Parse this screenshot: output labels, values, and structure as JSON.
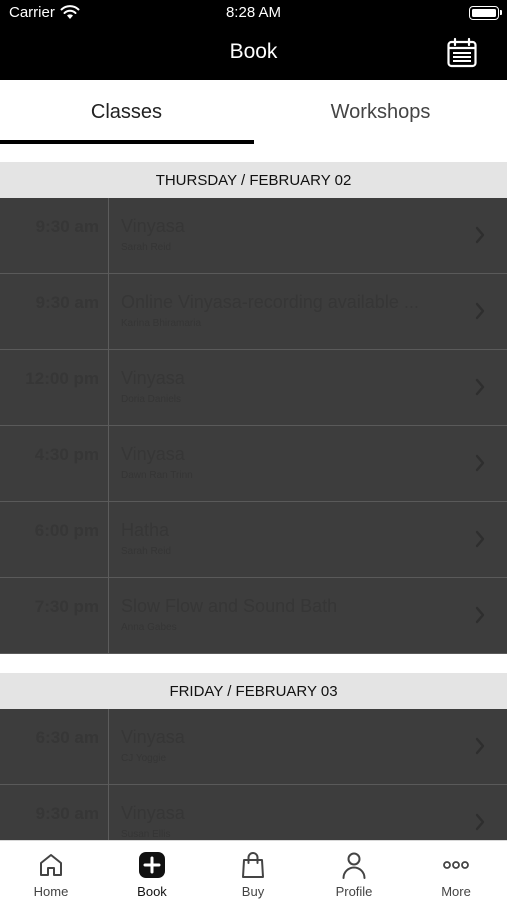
{
  "status": {
    "carrier": "Carrier",
    "time": "8:28 AM"
  },
  "nav": {
    "title": "Book"
  },
  "tabs": [
    {
      "label": "Classes"
    },
    {
      "label": "Workshops"
    }
  ],
  "days": [
    {
      "header": "THURSDAY / FEBRUARY 02",
      "rows": [
        {
          "time": "9:30 am",
          "name": "Vinyasa",
          "instructor": "Sarah Reid"
        },
        {
          "time": "9:30 am",
          "name": "Online Vinyasa-recording available ...",
          "instructor": "Karina Bhiramaria"
        },
        {
          "time": "12:00 pm",
          "name": "Vinyasa",
          "instructor": "Doria Daniels"
        },
        {
          "time": "4:30 pm",
          "name": "Vinyasa",
          "instructor": "Dawn Ran Trinn"
        },
        {
          "time": "6:00 pm",
          "name": "Hatha",
          "instructor": "Sarah Reid"
        },
        {
          "time": "7:30 pm",
          "name": "Slow Flow and Sound Bath",
          "instructor": "Anna Gabes"
        }
      ]
    },
    {
      "header": "FRIDAY / FEBRUARY 03",
      "rows": [
        {
          "time": "6:30 am",
          "name": "Vinyasa",
          "instructor": "CJ Yoggie"
        },
        {
          "time": "9:30 am",
          "name": "Vinyasa",
          "instructor": "Susan Ellis"
        }
      ]
    }
  ],
  "tabbar": [
    {
      "label": "Home",
      "icon": "home-icon"
    },
    {
      "label": "Book",
      "icon": "plus-square-icon"
    },
    {
      "label": "Buy",
      "icon": "shopping-bag-icon"
    },
    {
      "label": "Profile",
      "icon": "person-icon"
    },
    {
      "label": "More",
      "icon": "ellipsis-icon"
    }
  ]
}
